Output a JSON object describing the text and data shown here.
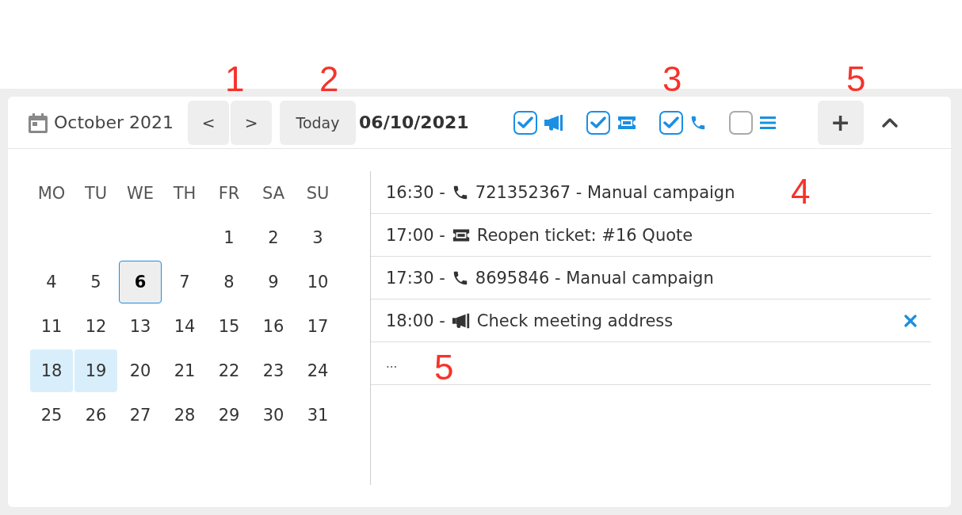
{
  "header": {
    "title": "October 2021",
    "prev": "<",
    "next": ">",
    "today": "Today",
    "date": "06/10/2021",
    "filters": [
      {
        "kind": "campaign",
        "checked": true
      },
      {
        "kind": "ticket",
        "checked": true
      },
      {
        "kind": "call",
        "checked": true
      },
      {
        "kind": "list",
        "checked": false
      }
    ],
    "add": "+"
  },
  "calendar": {
    "weekdays": [
      "MO",
      "TU",
      "WE",
      "TH",
      "FR",
      "SA",
      "SU"
    ],
    "weeks": [
      [
        {
          "label": "1",
          "selected": false,
          "highlighted": false
        },
        {
          "label": "2",
          "selected": false,
          "highlighted": false
        },
        {
          "label": "3",
          "selected": false,
          "highlighted": false
        }
      ],
      [
        {
          "label": "4",
          "selected": false,
          "highlighted": false
        },
        {
          "label": "5",
          "selected": false,
          "highlighted": false
        },
        {
          "label": "6",
          "selected": true,
          "highlighted": false
        },
        {
          "label": "7",
          "selected": false,
          "highlighted": false
        },
        {
          "label": "8",
          "selected": false,
          "highlighted": false
        },
        {
          "label": "9",
          "selected": false,
          "highlighted": false
        },
        {
          "label": "10",
          "selected": false,
          "highlighted": false
        }
      ],
      [
        {
          "label": "11",
          "selected": false,
          "highlighted": false
        },
        {
          "label": "12",
          "selected": false,
          "highlighted": false
        },
        {
          "label": "13",
          "selected": false,
          "highlighted": false
        },
        {
          "label": "14",
          "selected": false,
          "highlighted": false
        },
        {
          "label": "15",
          "selected": false,
          "highlighted": false
        },
        {
          "label": "16",
          "selected": false,
          "highlighted": false
        },
        {
          "label": "17",
          "selected": false,
          "highlighted": false
        }
      ],
      [
        {
          "label": "18",
          "selected": false,
          "highlighted": true
        },
        {
          "label": "19",
          "selected": false,
          "highlighted": true
        },
        {
          "label": "20",
          "selected": false,
          "highlighted": false
        },
        {
          "label": "21",
          "selected": false,
          "highlighted": false
        },
        {
          "label": "22",
          "selected": false,
          "highlighted": false
        },
        {
          "label": "23",
          "selected": false,
          "highlighted": false
        },
        {
          "label": "24",
          "selected": false,
          "highlighted": false
        }
      ],
      [
        {
          "label": "25",
          "selected": false,
          "highlighted": false
        },
        {
          "label": "26",
          "selected": false,
          "highlighted": false
        },
        {
          "label": "27",
          "selected": false,
          "highlighted": false
        },
        {
          "label": "28",
          "selected": false,
          "highlighted": false
        },
        {
          "label": "29",
          "selected": false,
          "highlighted": false
        },
        {
          "label": "30",
          "selected": false,
          "highlighted": false
        },
        {
          "label": "31",
          "selected": false,
          "highlighted": false
        }
      ]
    ]
  },
  "events": [
    {
      "kind": "call",
      "time": "16:30 -",
      "text": "721352367 - Manual campaign",
      "removable": false
    },
    {
      "kind": "ticket",
      "time": "17:00 -",
      "text": "Reopen ticket: #16 Quote",
      "removable": false
    },
    {
      "kind": "call",
      "time": "17:30 -",
      "text": "8695846 - Manual campaign",
      "removable": false
    },
    {
      "kind": "campaign",
      "time": "18:00 -",
      "text": "Check meeting address",
      "removable": true
    },
    {
      "kind": "more",
      "text": "..."
    }
  ],
  "annotations": [
    "1",
    "2",
    "3",
    "5",
    "4",
    "5"
  ]
}
